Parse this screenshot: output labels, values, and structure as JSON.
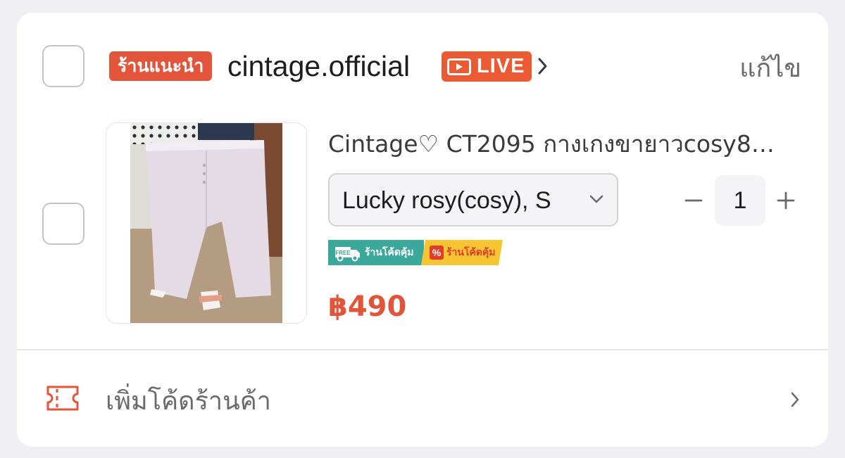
{
  "shop": {
    "badge": "ร้านแนะนำ",
    "name": "cintage.official",
    "live_label": "LIVE",
    "edit_label": "แก้ไข"
  },
  "item": {
    "title": "Cintage♡ CT2095 กางเกงขายาวcosy8…",
    "variant": "Lucky rosy(cosy), S",
    "quantity": "1",
    "promos": {
      "free_shipping_tag": "FREE",
      "free_shipping_label": "ร้านโค้ดคุ้ม",
      "discount_icon": "%",
      "discount_label": "ร้านโค้ดคุ้ม"
    },
    "price": "฿490"
  },
  "voucher": {
    "label": "เพิ่มโค้ดร้านค้า"
  },
  "colors": {
    "accent": "#e2553a",
    "live": "#ec5a34",
    "free_shipping": "#3aa89a",
    "discount_tag": "#f6c531"
  },
  "icons": [
    "video-icon",
    "chevron-right-icon",
    "chevron-down-icon",
    "minus-icon",
    "plus-icon",
    "truck-icon",
    "percent-icon",
    "voucher-ticket-icon"
  ]
}
